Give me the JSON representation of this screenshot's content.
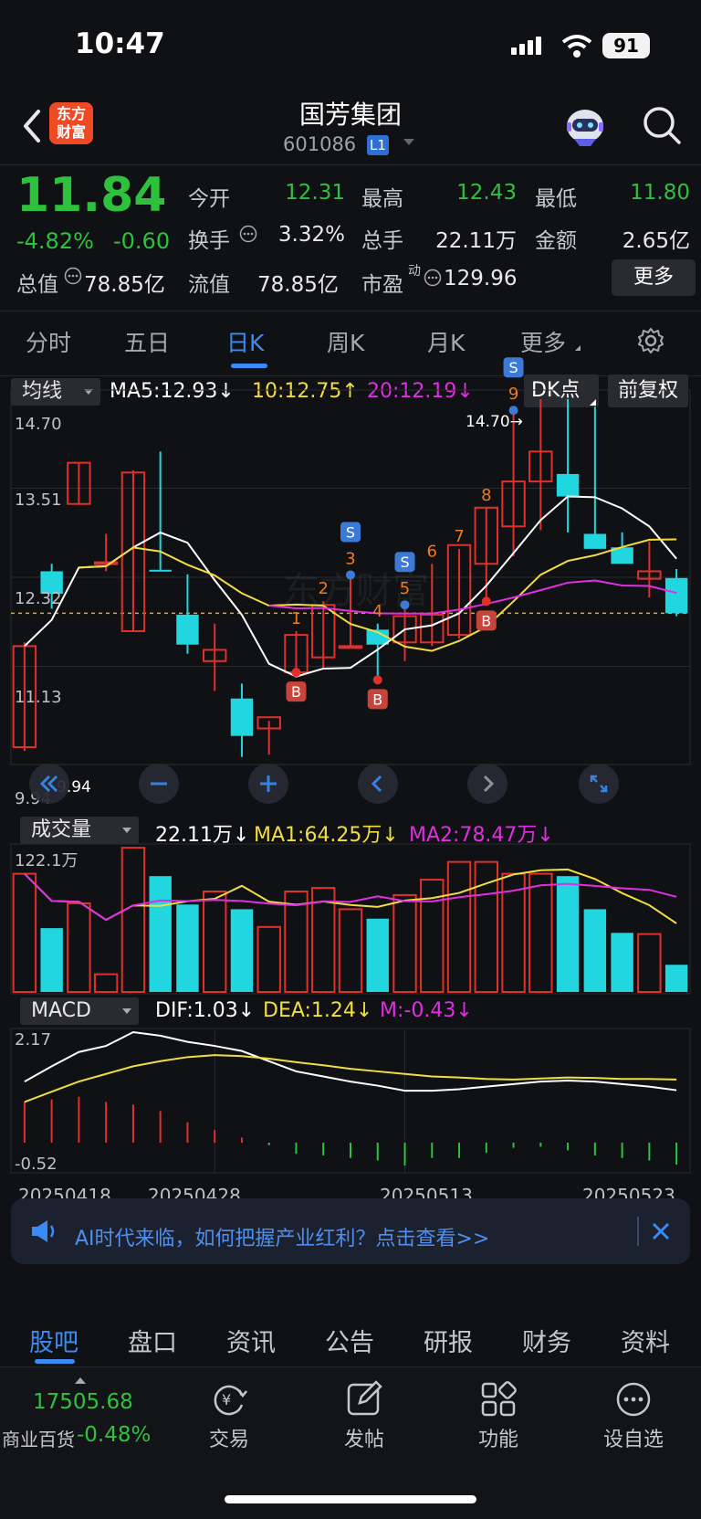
{
  "status_bar": {
    "time": "10:47",
    "battery": "91"
  },
  "header": {
    "title": "国芳集团",
    "code": "601086",
    "level_badge": "L1",
    "logo_line1": "东方",
    "logo_line2": "财富"
  },
  "quote": {
    "price": "11.84",
    "change_pct": "-4.82%",
    "change_amt": "-0.60",
    "rows": [
      [
        {
          "label": "今开",
          "value": "12.31",
          "green": true
        },
        {
          "label": "最高",
          "value": "12.43",
          "green": true
        },
        {
          "label": "最低",
          "value": "11.80",
          "green": true
        }
      ],
      [
        {
          "label": "换手",
          "value": "3.32%",
          "green": false
        },
        {
          "label": "总手",
          "value": "22.11万",
          "green": false
        },
        {
          "label": "金额",
          "value": "2.65亿",
          "green": false
        }
      ]
    ],
    "market_cap_label": "总值",
    "market_cap": "78.85亿",
    "float_cap_label": "流值",
    "float_cap": "78.85亿",
    "pe_label": "市盈",
    "pe_sup": "动",
    "pe": "129.96",
    "more_label": "更多"
  },
  "tabs": {
    "items": [
      "分时",
      "五日",
      "日K",
      "周K",
      "月K",
      "更多"
    ],
    "active_index": 2
  },
  "kline_panel": {
    "selector": "均线",
    "ma5": "MA5:12.93↓",
    "ma10": "10:12.75↑",
    "ma20": "20:12.19↓",
    "dk_button": "DK点",
    "adjust_button": "前复权",
    "axis": [
      "14.70",
      "13.51",
      "12.32",
      "11.13",
      "9.94"
    ],
    "high_marker": "14.70→",
    "low_marker": "9.94",
    "watermark": "东方财富"
  },
  "volume_panel": {
    "selector": "成交量",
    "vol": "22.11万↓",
    "ma1": "MA1:64.25万↓",
    "ma2": "MA2:78.47万↓",
    "axis_top": "122.1万"
  },
  "macd_panel": {
    "selector": "MACD",
    "dif": "DIF:1.03↓",
    "dea": "DEA:1.24↓",
    "m": "M:-0.43↓",
    "axis_top": "2.17",
    "axis_bottom": "-0.52"
  },
  "dates": [
    "20250418",
    "20250428",
    "20250513",
    "20250523"
  ],
  "colors": {
    "up": "#e0302b",
    "down": "#22d6df",
    "ma5": "#ffffff",
    "ma10": "#f2dd40",
    "ma20": "#e02ee0",
    "accent": "#3b8bf5",
    "green": "#2ec23c"
  },
  "chart_data": {
    "type": "candlestick",
    "ylim": [
      9.94,
      14.7
    ],
    "candles": [
      {
        "o": 10.05,
        "h": 11.45,
        "l": 10.0,
        "c": 11.4
      },
      {
        "o": 12.4,
        "h": 12.5,
        "l": 11.9,
        "c": 12.1
      },
      {
        "o": 13.3,
        "h": 13.85,
        "l": 13.3,
        "c": 13.85
      },
      {
        "o": 12.52,
        "h": 12.9,
        "l": 12.4,
        "c": 12.52
      },
      {
        "o": 11.6,
        "h": 13.75,
        "l": 11.6,
        "c": 13.72
      },
      {
        "o": 12.42,
        "h": 14.0,
        "l": 12.42,
        "c": 12.4
      },
      {
        "o": 11.82,
        "h": 12.36,
        "l": 11.3,
        "c": 11.42
      },
      {
        "o": 11.2,
        "h": 11.7,
        "l": 10.8,
        "c": 11.35
      },
      {
        "o": 10.7,
        "h": 10.9,
        "l": 9.92,
        "c": 10.2
      },
      {
        "o": 10.3,
        "h": 10.4,
        "l": 9.95,
        "c": 10.45
      },
      {
        "o": 11.05,
        "h": 11.6,
        "l": 11.0,
        "c": 11.55
      },
      {
        "o": 11.25,
        "h": 12.0,
        "l": 11.1,
        "c": 11.95
      },
      {
        "o": 11.4,
        "h": 12.4,
        "l": 11.4,
        "c": 11.4
      },
      {
        "o": 11.62,
        "h": 11.7,
        "l": 10.9,
        "c": 11.42
      },
      {
        "o": 11.45,
        "h": 12.0,
        "l": 11.2,
        "c": 11.8
      },
      {
        "o": 11.45,
        "h": 12.5,
        "l": 11.4,
        "c": 11.82
      },
      {
        "o": 11.55,
        "h": 12.7,
        "l": 11.5,
        "c": 12.75
      },
      {
        "o": 12.5,
        "h": 13.25,
        "l": 11.95,
        "c": 13.25
      },
      {
        "o": 13.0,
        "h": 14.6,
        "l": 12.6,
        "c": 13.6
      },
      {
        "o": 13.6,
        "h": 14.7,
        "l": 12.95,
        "c": 14.0
      },
      {
        "o": 13.7,
        "h": 14.7,
        "l": 12.92,
        "c": 13.4
      },
      {
        "o": 12.9,
        "h": 14.6,
        "l": 12.8,
        "c": 12.7
      },
      {
        "o": 12.72,
        "h": 12.92,
        "l": 12.55,
        "c": 12.5
      },
      {
        "o": 12.3,
        "h": 12.8,
        "l": 12.05,
        "c": 12.4
      },
      {
        "o": 12.31,
        "h": 12.43,
        "l": 11.8,
        "c": 11.84
      }
    ],
    "volume": [
      100,
      54,
      75,
      15,
      122,
      98,
      74,
      85,
      70,
      55,
      85,
      88,
      70,
      62,
      82,
      95,
      110,
      110,
      100,
      100,
      98,
      70,
      50,
      49,
      23
    ],
    "dif": [
      1.2,
      1.5,
      1.78,
      1.9,
      2.17,
      2.1,
      1.98,
      1.9,
      1.8,
      1.6,
      1.4,
      1.3,
      1.2,
      1.12,
      1.02,
      1.02,
      1.05,
      1.1,
      1.15,
      1.2,
      1.22,
      1.2,
      1.15,
      1.1,
      1.03
    ],
    "dea": [
      0.8,
      1.0,
      1.2,
      1.35,
      1.5,
      1.6,
      1.68,
      1.72,
      1.7,
      1.65,
      1.58,
      1.52,
      1.45,
      1.4,
      1.35,
      1.3,
      1.28,
      1.25,
      1.24,
      1.26,
      1.28,
      1.27,
      1.25,
      1.25,
      1.24
    ],
    "macd": [
      0.8,
      0.85,
      0.9,
      0.8,
      0.75,
      0.62,
      0.4,
      0.25,
      0.1,
      -0.05,
      -0.22,
      -0.25,
      -0.3,
      -0.35,
      -0.45,
      -0.3,
      -0.3,
      -0.2,
      -0.1,
      -0.08,
      -0.15,
      -0.25,
      -0.3,
      -0.35,
      -0.43
    ],
    "markers": [
      {
        "i": 10,
        "text": "B",
        "kind": "buy"
      },
      {
        "i": 12,
        "text": "S",
        "kind": "sell"
      },
      {
        "i": 13,
        "text": "B",
        "kind": "buy"
      },
      {
        "i": 14,
        "text": "S",
        "kind": "sell"
      },
      {
        "i": 17,
        "text": "B",
        "kind": "buy"
      },
      {
        "i": 18,
        "text": "S",
        "kind": "sell"
      }
    ],
    "numbers": [
      {
        "i": 10,
        "text": "1"
      },
      {
        "i": 11,
        "text": "2"
      },
      {
        "i": 12,
        "text": "3"
      },
      {
        "i": 13,
        "text": "4"
      },
      {
        "i": 14,
        "text": "5"
      },
      {
        "i": 15,
        "text": "6"
      },
      {
        "i": 16,
        "text": "7"
      },
      {
        "i": 17,
        "text": "8"
      },
      {
        "i": 18,
        "text": "9"
      }
    ]
  },
  "banner": {
    "text": "AI时代来临，如何把握产业红利？点击查看>>"
  },
  "bottom_tabs": {
    "items": [
      "股吧",
      "盘口",
      "资讯",
      "公告",
      "研报",
      "财务",
      "资料"
    ],
    "active_index": 0
  },
  "bottom_nav": {
    "index_value": "17505.68",
    "index_name": "商业百货",
    "index_change": "-0.48%",
    "items": [
      "交易",
      "发帖",
      "功能",
      "设自选"
    ]
  }
}
